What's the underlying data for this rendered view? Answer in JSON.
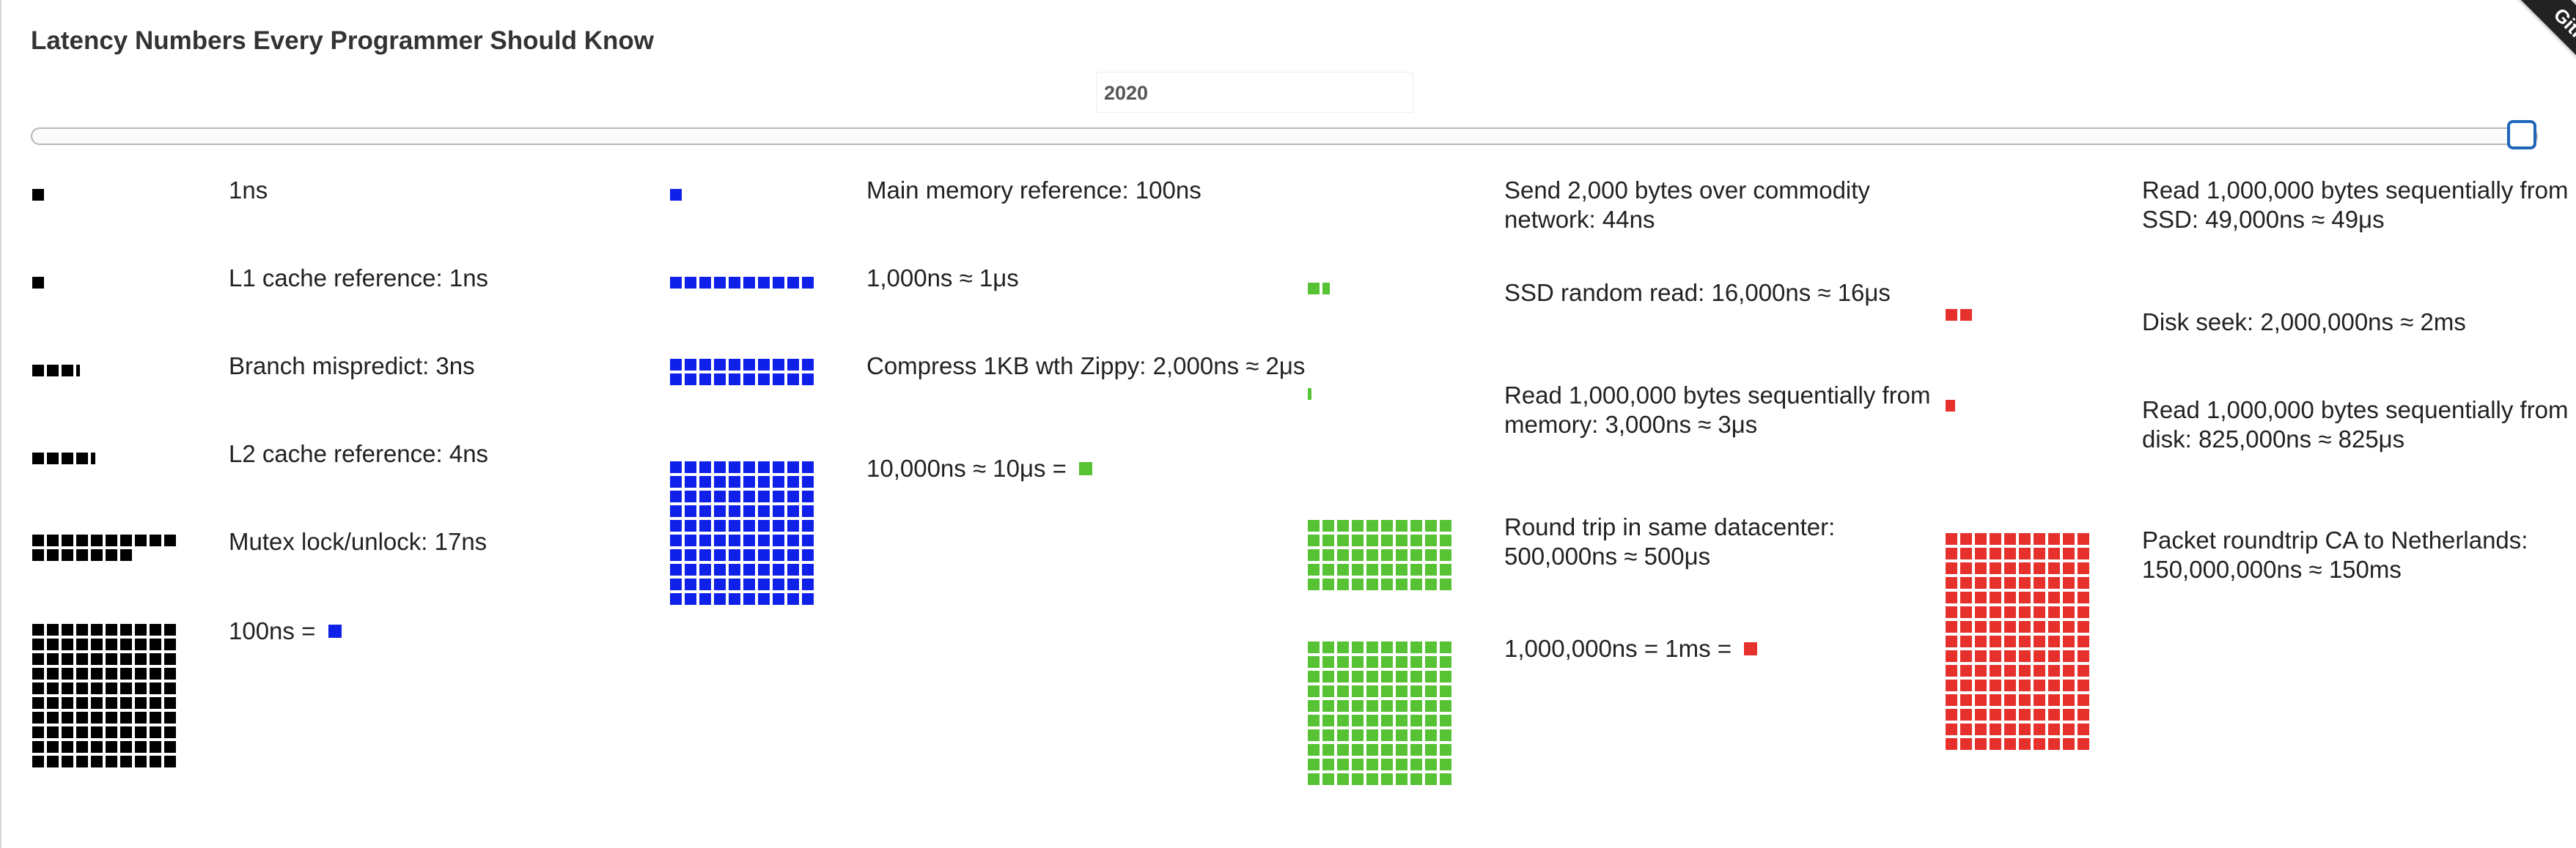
{
  "header": {
    "title": "Latency Numbers Every Programmer Should Know",
    "year": "2020",
    "ribbon_text": "GitHub"
  },
  "slider": {
    "value_label": "2020",
    "position_fraction": 1.0
  },
  "colors": {
    "ns": "#000000",
    "hundred_ns": "#0f20e8",
    "us": "#56c234",
    "ms": "#e6302c"
  },
  "latency_items": [
    {
      "label": "1ns",
      "color": "#000000",
      "units": 1,
      "equals_unit": null
    },
    {
      "label": "L1 cache reference: 1ns",
      "color": "#000000",
      "units": 1,
      "equals_unit": null
    },
    {
      "label": "Branch mispredict: 3ns",
      "color": "#000000",
      "units": 3,
      "partial": 0.3,
      "equals_unit": null
    },
    {
      "label": "L2 cache reference: 4ns",
      "color": "#000000",
      "units": 4,
      "partial": 0.4,
      "equals_unit": null
    },
    {
      "label": "Mutex lock/unlock: 17ns",
      "color": "#000000",
      "units": 17,
      "equals_unit": null
    },
    {
      "label": "100ns = ",
      "color": "#000000",
      "units": 100,
      "equals_unit": "#0f20e8"
    },
    {
      "label": "Main memory reference: 100ns",
      "color": "#0f20e8",
      "units": 1,
      "equals_unit": null
    },
    {
      "label": "1,000ns ≈ 1μs",
      "color": "#0f20e8",
      "units": 10,
      "equals_unit": null
    },
    {
      "label": "Compress 1KB wth Zippy: 2,000ns ≈ 2μs",
      "color": "#0f20e8",
      "units": 20,
      "equals_unit": null
    },
    {
      "label": "10,000ns ≈ 10μs = ",
      "color": "#0f20e8",
      "units": 100,
      "equals_unit": "#56c234"
    },
    {
      "label": "Send 2,000 bytes over commodity network: 44ns",
      "color": "#56c234",
      "units": 0,
      "equals_unit": null
    },
    {
      "label": "SSD random read: 16,000ns ≈ 16μs",
      "color": "#56c234",
      "units": 1,
      "partial": 0.6,
      "equals_unit": null
    },
    {
      "label": "Read 1,000,000 bytes sequentially from memory: 3,000ns ≈ 3μs",
      "color": "#56c234",
      "units": 0,
      "partial": 0.3,
      "equals_unit": null
    },
    {
      "label": "Round trip in same datacenter: 500,000ns ≈ 500μs",
      "color": "#56c234",
      "units": 50,
      "equals_unit": null
    },
    {
      "label": "1,000,000ns = 1ms = ",
      "color": "#56c234",
      "units": 100,
      "equals_unit": "#e6302c"
    },
    {
      "label": "Read 1,000,000 bytes sequentially from SSD: 49,000ns ≈ 49μs",
      "color": "#e6302c",
      "units": 0,
      "equals_unit": null
    },
    {
      "label": "Disk seek: 2,000,000ns ≈ 2ms",
      "color": "#e6302c",
      "units": 2,
      "equals_unit": null
    },
    {
      "label": "Read 1,000,000 bytes sequentially from disk: 825,000ns ≈ 825μs",
      "color": "#e6302c",
      "units": 0,
      "partial": 0.8,
      "equals_unit": null
    },
    {
      "label": "Packet roundtrip CA to Netherlands: 150,000,000ns ≈ 150ms",
      "color": "#e6302c",
      "units": 150,
      "equals_unit": null
    }
  ]
}
